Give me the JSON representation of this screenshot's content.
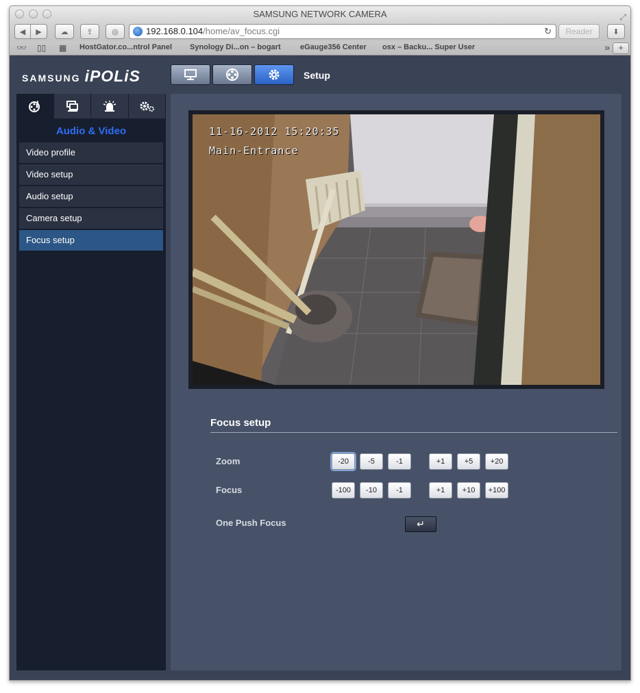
{
  "browser": {
    "title": "SAMSUNG NETWORK CAMERA",
    "url_host": "192.168.0.104",
    "url_path": "/home/av_focus.cgi",
    "reader_label": "Reader",
    "bookmarks": [
      "HostGator.co...ntrol Panel",
      "Synology Di...on – bogart",
      "eGauge356 Center",
      "osx – Backu... Super User"
    ],
    "add_label": "+",
    "more_label": "»"
  },
  "header": {
    "logo_brand": "SAMSUNG",
    "logo_product": "iPOLiS",
    "nav_title": "Setup",
    "nav_buttons": [
      "monitor-icon",
      "film-reel-icon",
      "gear-icon"
    ]
  },
  "sidebar": {
    "tabs": [
      "audio-video-icon",
      "network-icon",
      "alarm-icon",
      "system-icon"
    ],
    "section_title": "Audio & Video",
    "items": [
      {
        "label": "Video profile",
        "active": false
      },
      {
        "label": "Video setup",
        "active": false
      },
      {
        "label": "Audio setup",
        "active": false
      },
      {
        "label": "Camera setup",
        "active": false
      },
      {
        "label": "Focus setup",
        "active": true
      }
    ]
  },
  "video": {
    "timestamp": "11-16-2012 15:20:35",
    "camera_name": "Main-Entrance"
  },
  "focus_setup": {
    "title": "Focus setup",
    "zoom_label": "Zoom",
    "zoom_buttons": [
      "-20",
      "-5",
      "-1",
      "+1",
      "+5",
      "+20"
    ],
    "focus_label": "Focus",
    "focus_buttons": [
      "-100",
      "-10",
      "-1",
      "+1",
      "+10",
      "+100"
    ],
    "one_push_label": "One Push Focus",
    "one_push_icon": "↵"
  },
  "colors": {
    "accent_blue": "#2f6ef5",
    "active_item": "#2c5685",
    "panel_bg": "#475268"
  }
}
